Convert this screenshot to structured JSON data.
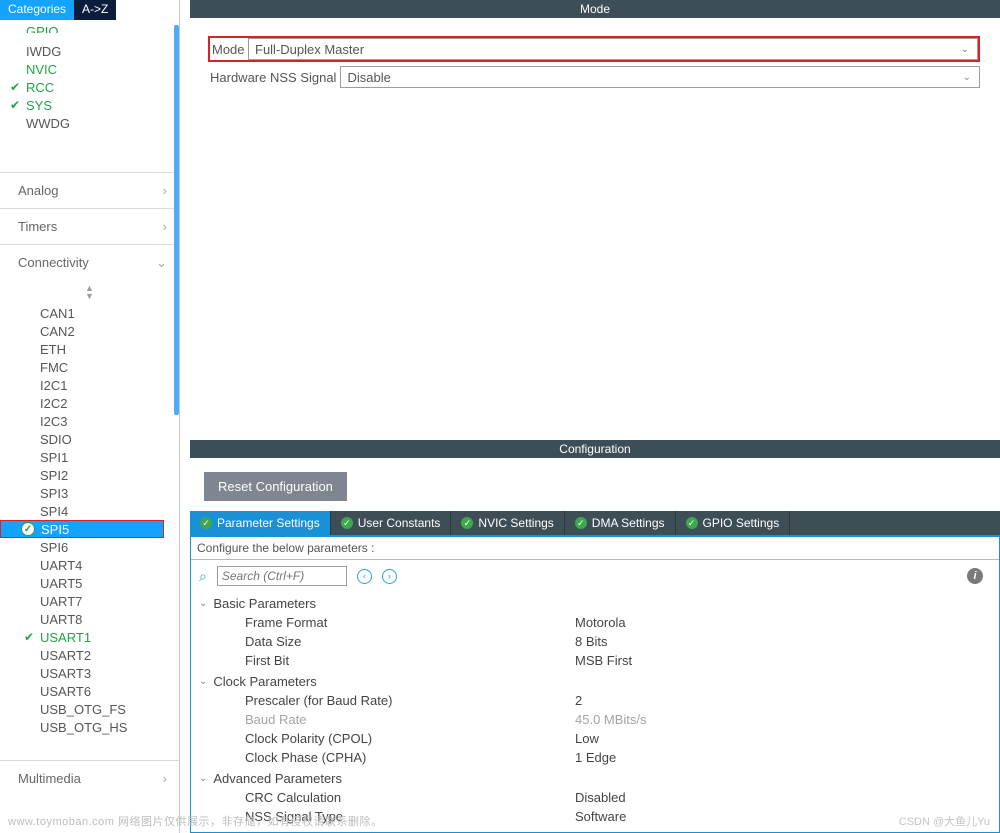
{
  "left": {
    "tabs": {
      "categories": "Categories",
      "az": "A->Z"
    },
    "system_items": [
      {
        "label": "GPIO",
        "green": true,
        "check": false,
        "clipped": true
      },
      {
        "label": "IWDG",
        "green": false,
        "check": false
      },
      {
        "label": "NVIC",
        "green": true,
        "check": false
      },
      {
        "label": "RCC",
        "green": true,
        "check": true
      },
      {
        "label": "SYS",
        "green": true,
        "check": true
      },
      {
        "label": "WWDG",
        "green": false,
        "check": false
      }
    ],
    "section_analog": "Analog",
    "section_timers": "Timers",
    "section_connectivity": "Connectivity",
    "conn_items": [
      {
        "label": "CAN1"
      },
      {
        "label": "CAN2"
      },
      {
        "label": "ETH"
      },
      {
        "label": "FMC"
      },
      {
        "label": "I2C1"
      },
      {
        "label": "I2C2"
      },
      {
        "label": "I2C3"
      },
      {
        "label": "SDIO"
      },
      {
        "label": "SPI1"
      },
      {
        "label": "SPI2"
      },
      {
        "label": "SPI3"
      },
      {
        "label": "SPI4"
      },
      {
        "label": "SPI5",
        "selected": true,
        "checked": true,
        "red": true
      },
      {
        "label": "SPI6"
      },
      {
        "label": "UART4"
      },
      {
        "label": "UART5"
      },
      {
        "label": "UART7"
      },
      {
        "label": "UART8"
      },
      {
        "label": "USART1",
        "green": true,
        "check": true
      },
      {
        "label": "USART2"
      },
      {
        "label": "USART3"
      },
      {
        "label": "USART6"
      },
      {
        "label": "USB_OTG_FS"
      },
      {
        "label": "USB_OTG_HS"
      }
    ],
    "section_multimedia": "Multimedia"
  },
  "mode": {
    "title": "Mode",
    "row1_label": "Mode",
    "row1_value": "Full-Duplex Master",
    "row2_label": "Hardware NSS Signal",
    "row2_value": "Disable"
  },
  "config": {
    "title": "Configuration",
    "reset": "Reset Configuration",
    "tabs": [
      "Parameter Settings",
      "User Constants",
      "NVIC Settings",
      "DMA Settings",
      "GPIO Settings"
    ],
    "subhead": "Configure the below parameters :",
    "search_placeholder": "Search (Ctrl+F)",
    "groups": [
      {
        "name": "Basic Parameters",
        "rows": [
          {
            "n": "Frame Format",
            "v": "Motorola"
          },
          {
            "n": "Data Size",
            "v": "8 Bits"
          },
          {
            "n": "First Bit",
            "v": "MSB First"
          }
        ]
      },
      {
        "name": "Clock Parameters",
        "rows": [
          {
            "n": "Prescaler (for Baud Rate)",
            "v": "2"
          },
          {
            "n": "Baud Rate",
            "v": "45.0 MBits/s",
            "dis": true
          },
          {
            "n": "Clock Polarity (CPOL)",
            "v": "Low"
          },
          {
            "n": "Clock Phase (CPHA)",
            "v": "1 Edge"
          }
        ]
      },
      {
        "name": "Advanced Parameters",
        "rows": [
          {
            "n": "CRC Calculation",
            "v": "Disabled"
          },
          {
            "n": "NSS Signal Type",
            "v": "Software"
          }
        ]
      }
    ]
  },
  "footer": {
    "left": "www.toymoban.com  网络图片仅供展示，非存储，如有侵权请联系删除。",
    "right": "CSDN @大鱼儿Yu"
  }
}
